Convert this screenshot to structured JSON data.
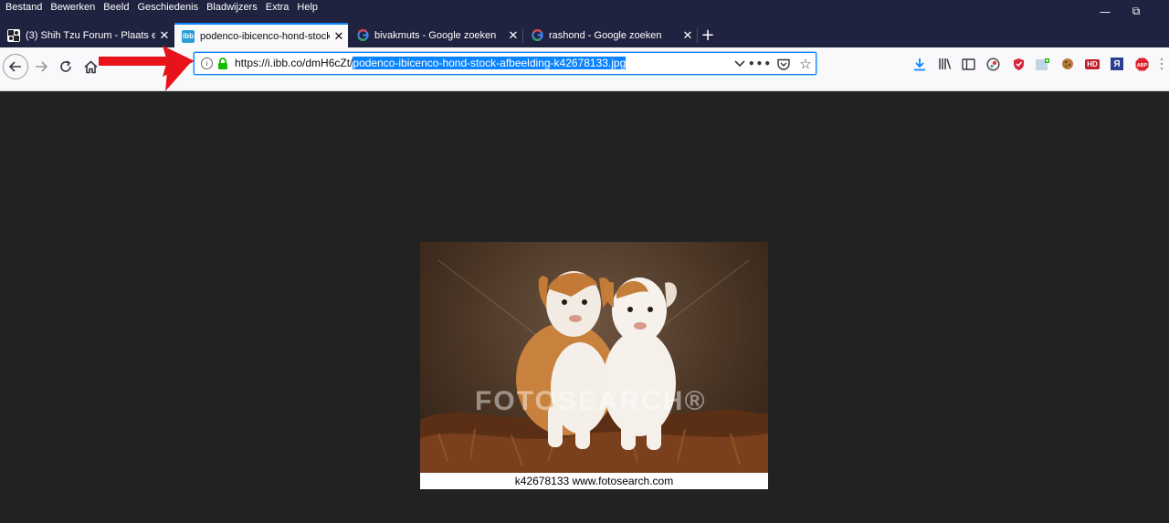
{
  "menu": [
    "Bestand",
    "Bewerken",
    "Beeld",
    "Geschiedenis",
    "Bladwijzers",
    "Extra",
    "Help"
  ],
  "window_controls": {
    "minimize": "—",
    "restore": "⧉"
  },
  "tabs": [
    {
      "label": "(3) Shih Tzu Forum - Plaats een",
      "favicon": "forum-icon",
      "active": false
    },
    {
      "label": "podenco-ibicenco-hond-stock-",
      "favicon": "ibb-icon",
      "favicon_text": "ibb",
      "active": true
    },
    {
      "label": "bivakmuts - Google zoeken",
      "favicon": "google-icon",
      "active": false
    },
    {
      "label": "rashond - Google zoeken",
      "favicon": "google-icon",
      "active": false
    }
  ],
  "new_tab": "+",
  "url": {
    "prefix": "https://i.ibb.co/dmH6cZt/",
    "selected": "podenco-ibicenco-hond-stock-afbeelding-k42678133.jpg"
  },
  "toolbar_icons": [
    "download-icon",
    "library-icon",
    "sidebar-icon",
    "ext-1-icon",
    "ext-shield-icon",
    "ext-screenshot-icon",
    "ext-cookie-icon",
    "ext-hd-icon",
    "ext-yandex-icon",
    "ext-abp-icon",
    "overflow-icon"
  ],
  "image": {
    "watermark": "FOTOSEARCH®",
    "caption": "k42678133  www.fotosearch.com"
  },
  "colors": {
    "title_bar": "#202340",
    "accent": "#0a84ff",
    "arrow": "#e8121a",
    "content_bg": "#222222"
  }
}
